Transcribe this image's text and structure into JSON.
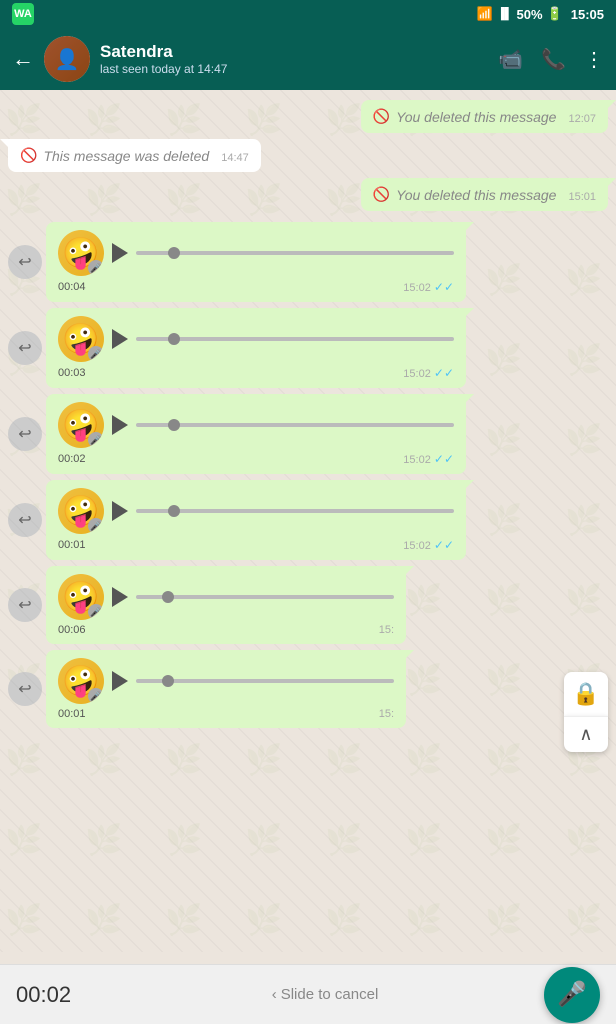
{
  "statusBar": {
    "time": "15:05",
    "battery": "50%",
    "appIcon": "WA"
  },
  "header": {
    "backLabel": "←",
    "contactName": "Satendra",
    "lastSeen": "last seen today at 14:47",
    "videoIcon": "📹",
    "callIcon": "📞",
    "menuIcon": "⋮"
  },
  "messages": [
    {
      "type": "deleted-sent",
      "text": "You deleted this message",
      "time": "12:07"
    },
    {
      "type": "deleted-received",
      "text": "This message was deleted",
      "time": "14:47"
    },
    {
      "type": "deleted-sent",
      "text": "You deleted this message",
      "time": "15:01"
    },
    {
      "type": "voice-sent",
      "duration": "00:04",
      "time": "15:02",
      "read": true
    },
    {
      "type": "voice-sent",
      "duration": "00:03",
      "time": "15:02",
      "read": true
    },
    {
      "type": "voice-sent",
      "duration": "00:02",
      "time": "15:02",
      "read": true
    },
    {
      "type": "voice-sent",
      "duration": "00:01",
      "time": "15:02",
      "read": true
    },
    {
      "type": "voice-sent",
      "duration": "00:06",
      "time": "15:",
      "read": false,
      "partial": true
    },
    {
      "type": "voice-sent",
      "duration": "00:01",
      "time": "15:",
      "read": false,
      "partial": true
    }
  ],
  "bottomBar": {
    "timer": "00:02",
    "slideLabel": "Slide to cancel",
    "slideIcon": "‹",
    "micIcon": "🎤"
  },
  "lockOverlay": {
    "lockIcon": "🔒",
    "upIcon": "∧"
  }
}
